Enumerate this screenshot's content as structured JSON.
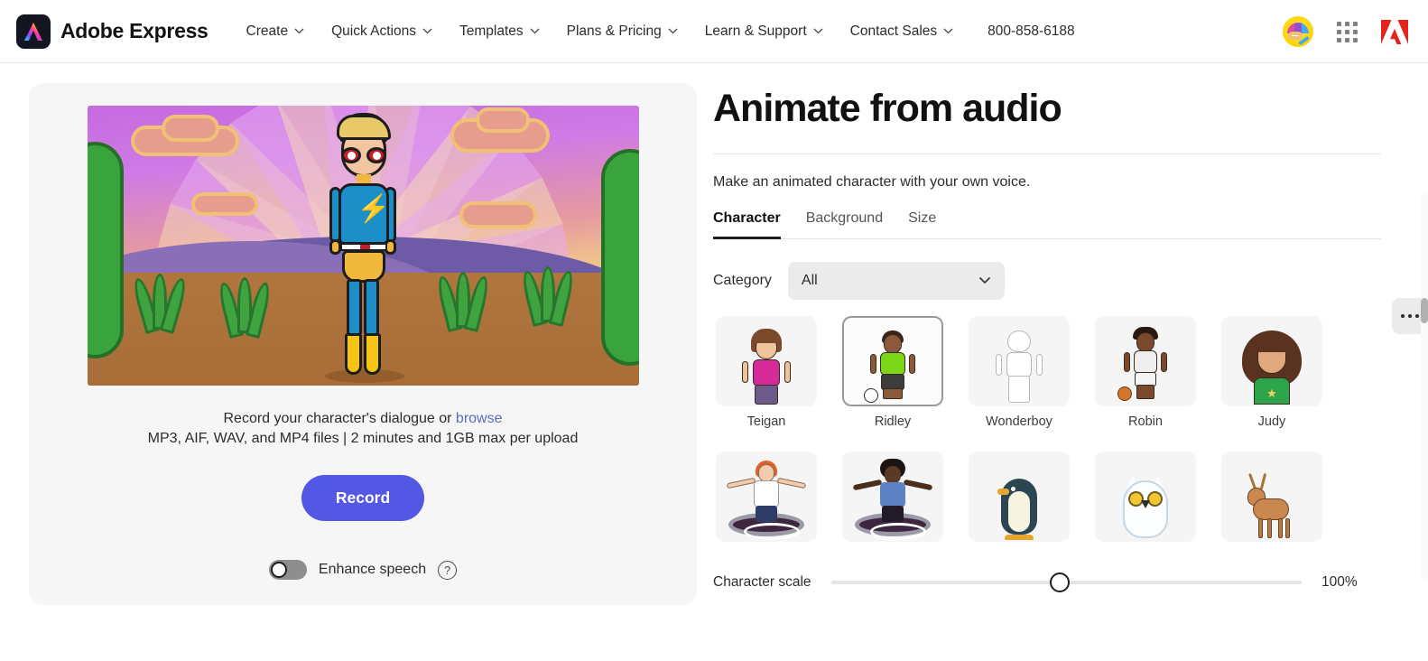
{
  "header": {
    "brand_name": "Adobe Express",
    "logo_icon": "adobe-express-logo",
    "nav": [
      {
        "label": "Create",
        "icon": "chevron-down-icon"
      },
      {
        "label": "Quick Actions",
        "icon": "chevron-down-icon"
      },
      {
        "label": "Templates",
        "icon": "chevron-down-icon"
      },
      {
        "label": "Plans & Pricing",
        "icon": "chevron-down-icon"
      },
      {
        "label": "Learn & Support",
        "icon": "chevron-down-icon"
      },
      {
        "label": "Contact Sales",
        "icon": "chevron-down-icon"
      }
    ],
    "phone": "800-858-6188",
    "avatar_icon": "user-avatar-rainbow",
    "apps_icon": "app-grid-icon",
    "adobe_icon": "adobe-logo-icon"
  },
  "left_panel": {
    "preview_alt": "superhero character on sunset landscape",
    "hint_line1_before": "Record your character's dialogue or",
    "hint_browse": "browse",
    "hint_line2": "MP3, AIF, WAV, and MP4 files | 2 minutes and 1GB max per upload",
    "record_label": "Record",
    "enhance_label": "Enhance speech",
    "enhance_state": "off",
    "help_icon": "question-mark-icon"
  },
  "right_panel": {
    "title": "Animate from audio",
    "subtitle": "Make an animated character with your own voice.",
    "tabs": [
      {
        "label": "Character",
        "active": true
      },
      {
        "label": "Background",
        "active": false
      },
      {
        "label": "Size",
        "active": false
      }
    ],
    "more_icon": "more-options-icon",
    "category_label": "Category",
    "category_value": "All",
    "category_chevron": "chevron-down-icon",
    "characters": [
      {
        "name": "Teigan",
        "selected": false
      },
      {
        "name": "Ridley",
        "selected": true
      },
      {
        "name": "Wonderboy",
        "selected": false
      },
      {
        "name": "Robin",
        "selected": false
      },
      {
        "name": "Judy",
        "selected": false
      },
      {
        "name": "",
        "selected": false
      },
      {
        "name": "",
        "selected": false
      },
      {
        "name": "",
        "selected": false
      },
      {
        "name": "",
        "selected": false
      },
      {
        "name": "",
        "selected": false
      }
    ],
    "scale_label": "Character scale",
    "scale_value": "100%"
  },
  "colors": {
    "accent_record": "#5258e4",
    "link": "#5c6ac4",
    "adobe_red": "#e1251b",
    "tab_active_underline": "#1d1d1d",
    "card_bg": "#f6f6f6",
    "control_bg": "#ebebeb"
  }
}
